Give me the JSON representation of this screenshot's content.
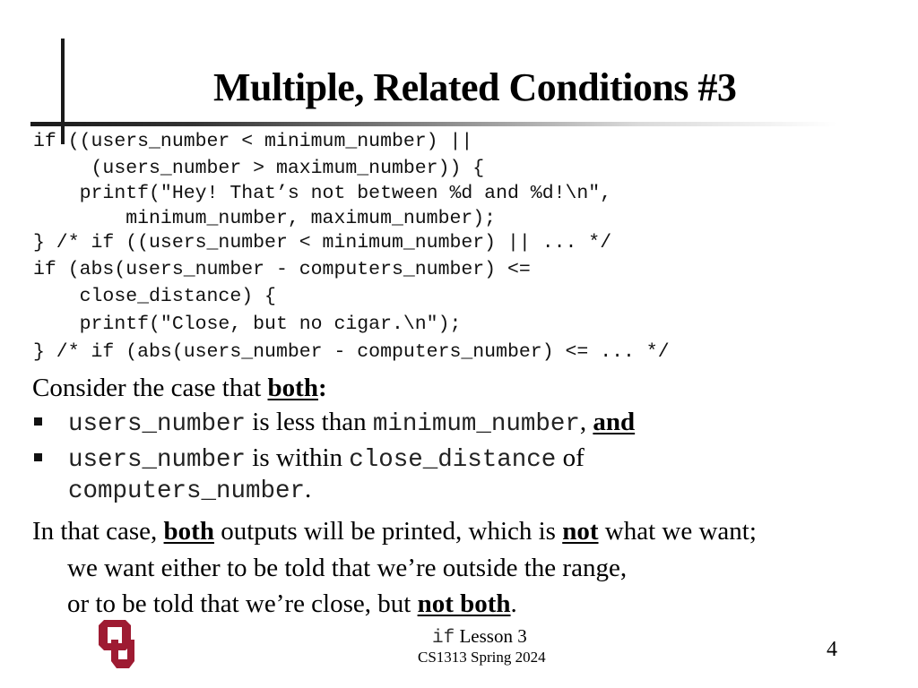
{
  "slide": {
    "title": "Multiple, Related Conditions #3",
    "code_lines": [
      "if ((users_number < minimum_number) ||",
      "     (users_number > maximum_number)) {",
      "    printf(\"Hey! That’s not between %d and %d!\\n\",",
      "        minimum_number, maximum_number);",
      "} /* if ((users_number < minimum_number) || ... */",
      "if (abs(users_number - computers_number) <=",
      "    close_distance) {",
      "    printf(\"Close, but no cigar.\\n\");",
      "} /* if (abs(users_number - computers_number) <= ... */"
    ],
    "consider": {
      "prefix": "Consider the case that ",
      "emphasis": "both",
      "suffix": ":"
    },
    "bullets": [
      {
        "code1": "users_number",
        "text1": " is less than ",
        "code2": "minimum_number",
        "text2": ", ",
        "emphasis": "and"
      },
      {
        "code1": "users_number",
        "text1": " is within ",
        "code2": "close_distance",
        "text2": " of",
        "code3": "computers_number",
        "text3": "."
      }
    ],
    "conclusion": {
      "line1_a": "In that case, ",
      "line1_emph1": "both",
      "line1_b": " outputs will be printed, which is ",
      "line1_emph2": "not",
      "line1_c": " what we want;",
      "line2": "we want either to be told that we’re outside the range,",
      "line3_a": "or to be told that we’re close, but ",
      "line3_emph": "not both",
      "line3_b": "."
    }
  },
  "footer": {
    "lesson_code": "if",
    "lesson_text": " Lesson 3",
    "course": "CS1313 Spring 2024",
    "page_number": "4",
    "logo": "ou-logo",
    "logo_color": "#9e1b32"
  }
}
